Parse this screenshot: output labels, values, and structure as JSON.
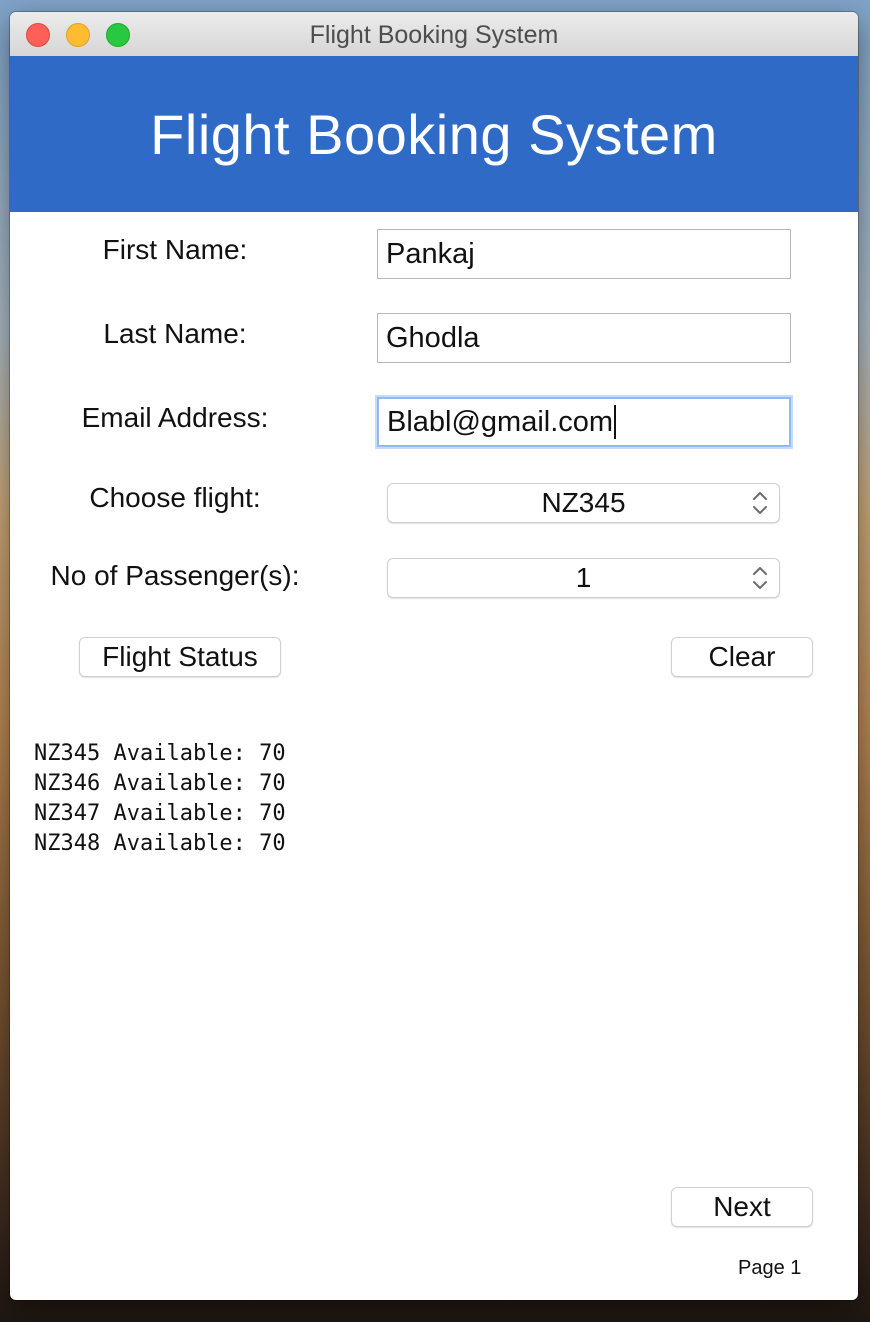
{
  "window": {
    "title": "Flight Booking System"
  },
  "header": {
    "title": "Flight Booking System"
  },
  "form": {
    "first_name_label": "First Name:",
    "first_name_value": "Pankaj",
    "last_name_label": "Last Name:",
    "last_name_value": "Ghodla",
    "email_label": "Email Address:",
    "email_value": "Blabl@gmail.com",
    "flight_label": "Choose flight:",
    "flight_value": "NZ345",
    "passengers_label": "No of Passenger(s):",
    "passengers_value": "1"
  },
  "buttons": {
    "flight_status": "Flight Status",
    "clear": "Clear",
    "next": "Next"
  },
  "flight_status": [
    "NZ345 Available: 70",
    "NZ346 Available: 70",
    "NZ347 Available: 70",
    "NZ348 Available: 70"
  ],
  "footer": {
    "page": "Page 1"
  },
  "colors": {
    "header_bg": "#2f6bc6",
    "focus_ring": "#8fbbf0"
  }
}
